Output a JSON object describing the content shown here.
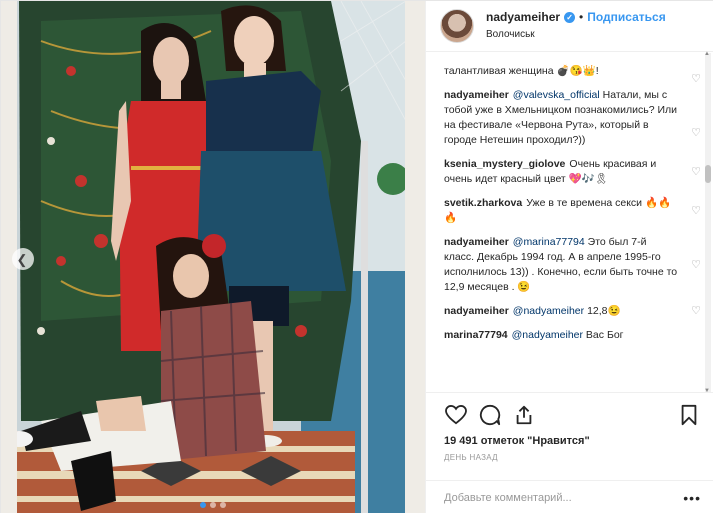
{
  "header": {
    "username": "nadyameiher",
    "separator": "•",
    "follow_label": "Подписаться",
    "location": "Волочиськ"
  },
  "comments": [
    {
      "user": "",
      "text": "талантливая женщина 💣😘👑!"
    },
    {
      "user": "nadyameiher",
      "mention": "@valevska_official",
      "text": " Натали, мы с тобой уже в Хмельницком познакомились? Или на фестивале «Червона Рута», который в городе Нетешин проходил?))"
    },
    {
      "user": "ksenia_mystery_giolove",
      "text": "Очень красивая и очень идет красный цвет 💖🎶🎗"
    },
    {
      "user": "svetik.zharkova",
      "text": "Уже в те времена секси 🔥🔥🔥"
    },
    {
      "user": "nadyameiher",
      "mention": "@marina77794",
      "text": " Это был 7-й класс. Декабрь 1994 год. А в апреле 1995-го исполнилось 13)) . Конечно, если быть точне то 12,9 месяцев . 😉"
    },
    {
      "user": "nadyameiher",
      "mention": "@nadyameiher",
      "text": " 12,8😉"
    },
    {
      "user": "marina77794",
      "mention": "@nadyameiher",
      "text": " Вас Бог"
    }
  ],
  "actions": {
    "likes": "19 491 отметок \"Нравится\"",
    "time": "день назад",
    "comment_placeholder": "Добавьте комментарий...",
    "more": "•••"
  },
  "photo": {
    "slides": 3,
    "active_slide": 1
  }
}
